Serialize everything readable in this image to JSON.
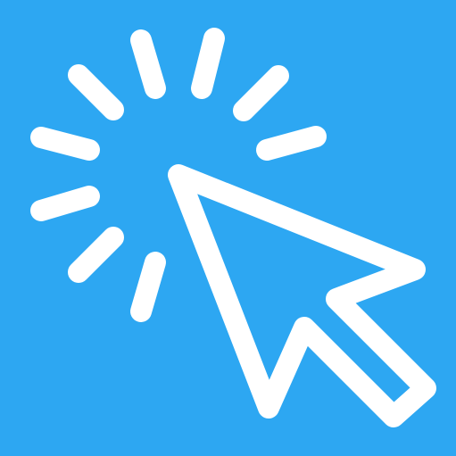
{
  "icon": {
    "name": "click-cursor-icon",
    "background_color": "#2DA7F2",
    "foreground_color": "#FFFFFF"
  }
}
